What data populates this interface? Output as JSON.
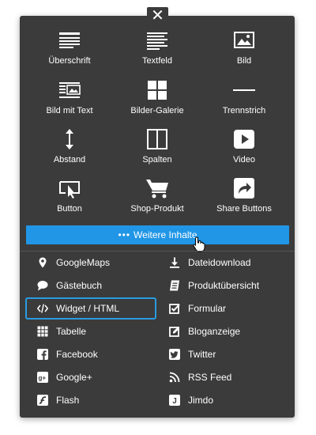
{
  "close": {
    "symbol": "✕"
  },
  "tiles": [
    {
      "label": "Überschrift",
      "icon": "heading-icon"
    },
    {
      "label": "Textfeld",
      "icon": "text-icon"
    },
    {
      "label": "Bild",
      "icon": "image-icon"
    },
    {
      "label": "Bild mit Text",
      "icon": "image-text-icon"
    },
    {
      "label": "Bilder-Galerie",
      "icon": "gallery-icon"
    },
    {
      "label": "Trennstrich",
      "icon": "divider-icon"
    },
    {
      "label": "Abstand",
      "icon": "spacing-icon"
    },
    {
      "label": "Spalten",
      "icon": "columns-icon"
    },
    {
      "label": "Video",
      "icon": "video-icon"
    },
    {
      "label": "Button",
      "icon": "button-icon"
    },
    {
      "label": "Shop-Produkt",
      "icon": "cart-icon"
    },
    {
      "label": "Share Buttons",
      "icon": "share-icon"
    }
  ],
  "more": {
    "label": "Weitere Inhalte",
    "dots": "•••"
  },
  "list_left": [
    {
      "label": "GoogleMaps",
      "icon": "map-pin-icon"
    },
    {
      "label": "Gästebuch",
      "icon": "speech-bubble-icon"
    },
    {
      "label": "Widget / HTML",
      "icon": "code-icon"
    },
    {
      "label": "Tabelle",
      "icon": "table-icon"
    },
    {
      "label": "Facebook",
      "icon": "facebook-icon"
    },
    {
      "label": "Google+",
      "icon": "google-plus-icon"
    },
    {
      "label": "Flash",
      "icon": "flash-icon"
    }
  ],
  "list_right": [
    {
      "label": "Dateidownload",
      "icon": "download-icon"
    },
    {
      "label": "Produktübersicht",
      "icon": "catalog-icon"
    },
    {
      "label": "Formular",
      "icon": "form-icon"
    },
    {
      "label": "Bloganzeige",
      "icon": "blog-icon"
    },
    {
      "label": "Twitter",
      "icon": "twitter-icon"
    },
    {
      "label": "RSS Feed",
      "icon": "rss-icon"
    },
    {
      "label": "Jimdo",
      "icon": "jimdo-icon"
    }
  ],
  "colors": {
    "panel": "#3b3b3b",
    "accent": "#2196e6",
    "highlight": "#2a9be0"
  }
}
